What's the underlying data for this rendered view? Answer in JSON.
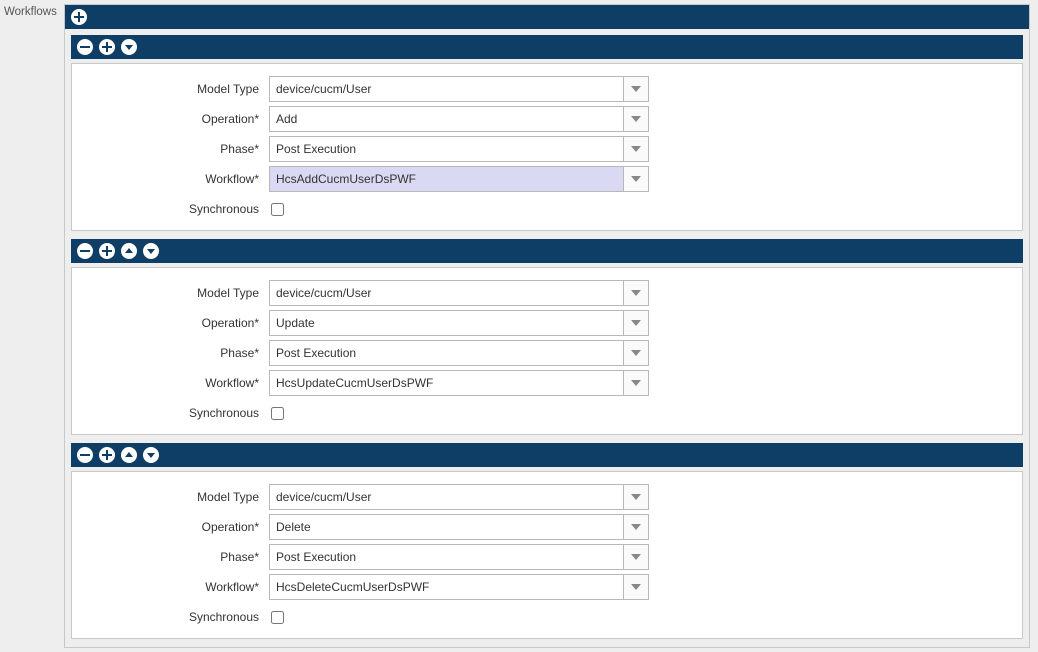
{
  "sidebar": {
    "section_label": "Workflows"
  },
  "labels": {
    "model_type": "Model Type",
    "operation": "Operation*",
    "phase": "Phase*",
    "workflow": "Workflow*",
    "synchronous": "Synchronous"
  },
  "sections": [
    {
      "model_type": "device/cucm/User",
      "operation": "Add",
      "phase": "Post Execution",
      "workflow": "HcsAddCucmUserDsPWF",
      "workflow_highlighted": true,
      "synchronous": false,
      "header_buttons": 3
    },
    {
      "model_type": "device/cucm/User",
      "operation": "Update",
      "phase": "Post Execution",
      "workflow": "HcsUpdateCucmUserDsPWF",
      "workflow_highlighted": false,
      "synchronous": false,
      "header_buttons": 4
    },
    {
      "model_type": "device/cucm/User",
      "operation": "Delete",
      "phase": "Post Execution",
      "workflow": "HcsDeleteCucmUserDsPWF",
      "workflow_highlighted": false,
      "synchronous": false,
      "header_buttons": 4
    }
  ]
}
